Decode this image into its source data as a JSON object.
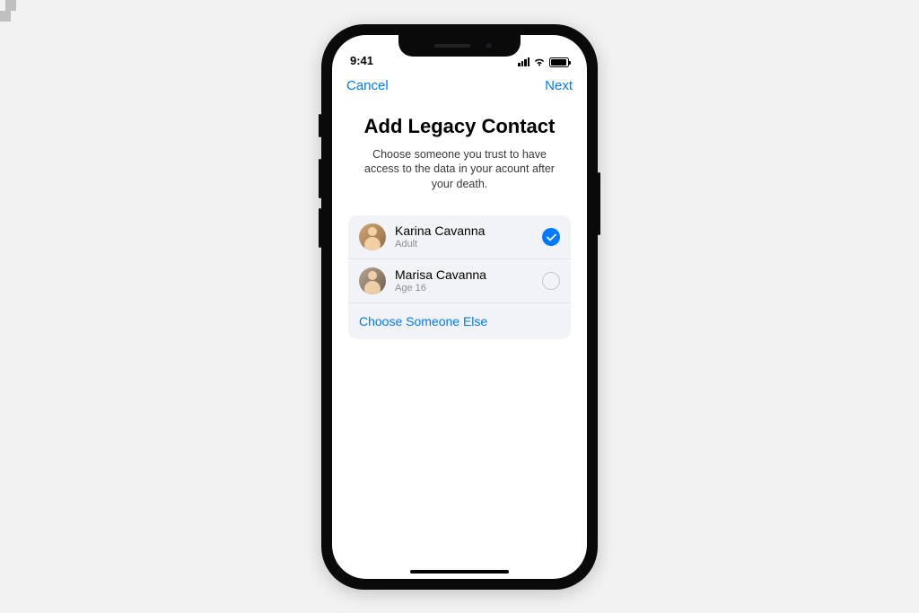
{
  "status_bar": {
    "time": "9:41"
  },
  "nav": {
    "cancel": "Cancel",
    "next": "Next"
  },
  "page": {
    "title": "Add Legacy Contact",
    "subtitle": "Choose someone you trust to have access to the data in your acount after your death."
  },
  "contacts": [
    {
      "name": "Karina Cavanna",
      "sub": "Adult",
      "selected": true
    },
    {
      "name": "Marisa Cavanna",
      "sub": "Age 16",
      "selected": false
    }
  ],
  "choose_else_label": "Choose Someone Else"
}
